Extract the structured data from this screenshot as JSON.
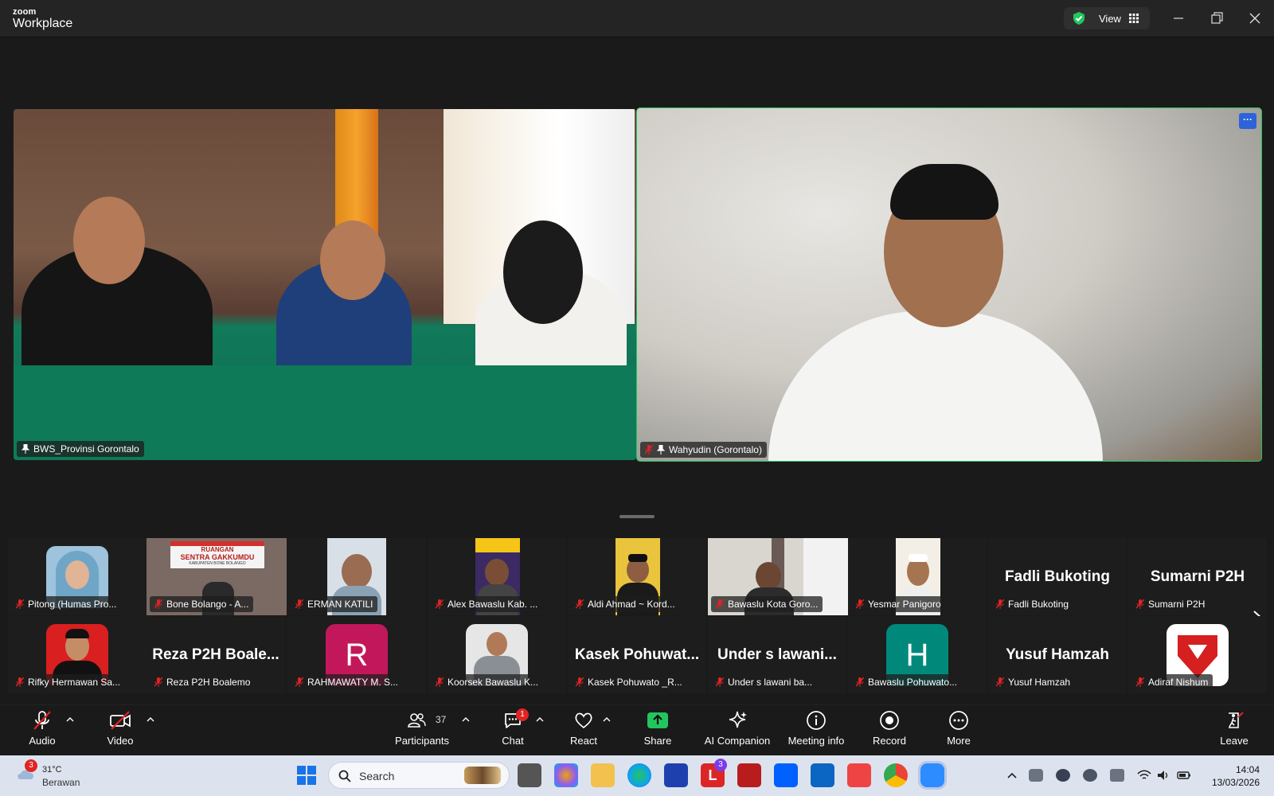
{
  "app": {
    "brand_small": "zoom",
    "brand_big": "Workplace",
    "view_label": "View"
  },
  "main_tiles": [
    {
      "name": "BWS_Provinsi Gorontalo",
      "muted": false,
      "pinned": true
    },
    {
      "name": "Wahyudin (Gorontalo)",
      "muted": true,
      "pinned": true,
      "active_speaker": true
    }
  ],
  "gallery": [
    {
      "label": "Pitong (Humas Pro...",
      "kind": "avatar"
    },
    {
      "label": "Bone Bolango - A...",
      "kind": "video",
      "banner_line1": "RUANGAN",
      "banner_line2": "SENTRA GAKKUMDU",
      "banner_line3": "KABUPATEN BONE BOLANGO"
    },
    {
      "label": "ERMAN KATILI",
      "kind": "video"
    },
    {
      "label": "Alex Bawaslu Kab. ...",
      "kind": "video"
    },
    {
      "label": "Aldi Ahmad ~ Kord...",
      "kind": "video"
    },
    {
      "label": "Bawaslu Kota Goro...",
      "kind": "video"
    },
    {
      "label": "Yesmar Panigoro",
      "kind": "video"
    },
    {
      "label": "Fadli Bukoting",
      "kind": "name",
      "display": "Fadli Bukoting"
    },
    {
      "label": "Sumarni P2H",
      "kind": "name",
      "display": "Sumarni P2H"
    },
    {
      "label": "Rifky Hermawan Sa...",
      "kind": "avatar"
    },
    {
      "label": "Reza P2H Bo​alemo",
      "kind": "name",
      "display": "Reza P2H Boale..."
    },
    {
      "label": "RAHMAWATY M. S...",
      "kind": "letter",
      "letter": "R",
      "color": "#c2185b"
    },
    {
      "label": "Koorsek Bawaslu K...",
      "kind": "avatar"
    },
    {
      "label": "Kasek Pohuwato _R...",
      "kind": "name",
      "display": "Kasek Pohuwat..."
    },
    {
      "label": "Under s lawani ba...",
      "kind": "name",
      "display": "Under s lawani..."
    },
    {
      "label": "Bawaslu Pohuwato...",
      "kind": "letter",
      "letter": "H",
      "color": "#00897b"
    },
    {
      "label": "Yusuf Hamzah",
      "kind": "name",
      "display": "Yusuf Hamzah"
    },
    {
      "label": "Adiraf Nishum",
      "kind": "avatar"
    }
  ],
  "toolbar": {
    "audio": "Audio",
    "video": "Video",
    "participants": "Participants",
    "participants_count": "37",
    "chat": "Chat",
    "chat_badge": "1",
    "react": "React",
    "share": "Share",
    "ai_companion": "AI Companion",
    "meeting_info": "Meeting info",
    "record": "Record",
    "more": "More",
    "leave": "Leave"
  },
  "taskbar": {
    "weather_badge": "3",
    "temperature": "31°C",
    "weather_desc": "Berawan",
    "search_placeholder": "Search",
    "mail_badge": "3",
    "time": "14:04",
    "date": "13/03/2026"
  },
  "colors": {
    "active_speaker": "#22c55e",
    "leave": "#e02424",
    "share": "#22c55e"
  }
}
